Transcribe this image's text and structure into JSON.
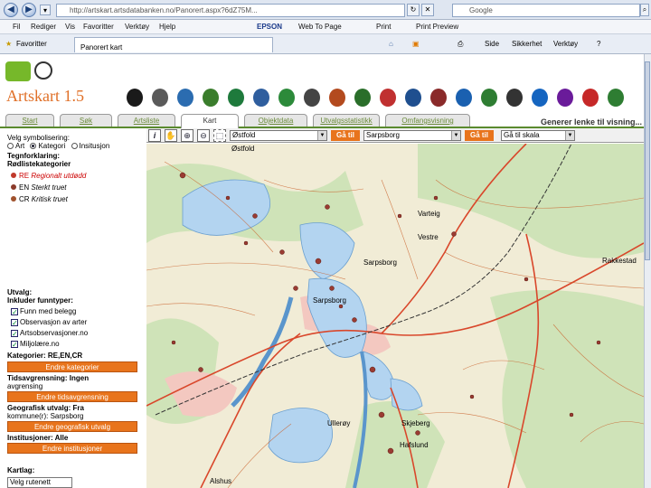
{
  "browser": {
    "url": "http://artskart.artsdatabanken.no/Panorert.aspx?6dZ75M...",
    "search_engine": "Google",
    "menu": [
      "Fil",
      "Rediger",
      "Vis",
      "Favoritter",
      "Verktøy",
      "Hjelp"
    ],
    "menu_extras": [
      "EPSON",
      "Web To Page",
      "Print",
      "Print Preview"
    ],
    "favorites_label": "Favoritter",
    "tab_title": "Panorert kart",
    "command_items": [
      "Side",
      "Sikkerhet",
      "Verktøy"
    ]
  },
  "app": {
    "title": "Artskart 1.5",
    "partner_logos": [
      "artsdatabanken-logo",
      "sabima-logo",
      "bio-logo",
      "biof-logo",
      "bioforsk-logo",
      "partner-logo-1",
      "partner-logo-2",
      "partner-logo-3",
      "partner-logo-4",
      "partner-logo-5",
      "partner-logo-6",
      "partner-logo-7",
      "partner-logo-8",
      "niva-logo",
      "partner-logo-9",
      "partner-logo-10",
      "partner-logo-11",
      "partner-logo-12",
      "partner-logo-13",
      "partner-logo-14"
    ],
    "tabs": [
      "Start",
      "Søk",
      "Artsliste",
      "Kart",
      "Objektdata",
      "Utvalgsstatistikk",
      "Omfangsvisning"
    ],
    "active_tab": "Kart",
    "generate_link": "Generer lenke til visning..."
  },
  "left_panel": {
    "symbol_heading": "Velg symbolisering:",
    "symbol_options": [
      "Art",
      "Kategori",
      "Insitusjon"
    ],
    "legend_heading": "Tegnforklaring:",
    "legend_subheading": "Rødlistekategorier",
    "legend_items": [
      {
        "code": "RE",
        "label": "Regionalt utdødd",
        "color": "#c0392b"
      },
      {
        "code": "EN",
        "label": "Sterkt truet",
        "color": "#8b3a2a"
      },
      {
        "code": "CR",
        "label": "Kritisk truet",
        "color": "#a0522d"
      }
    ],
    "selection_heading": "Utvalg:",
    "include_heading": "Inkluder funntyper:",
    "checkboxes": [
      "Funn med belegg",
      "Observasjon av arter",
      "Artsobservasjoner.no",
      "Miljolære.no"
    ],
    "categories_label": "Kategorier: RE,EN,CR",
    "btn_categories": "Endre kategorier",
    "time_label": "Tidsavgrensning: Ingen",
    "time_sub": "avgrensing",
    "btn_time": "Endre tidsavgrensning",
    "geo_label": "Geografisk utvalg: Fra",
    "geo_sub": "kommune(r): Sarpsborg",
    "btn_geo": "Endre geografisk utvalg",
    "inst_label": "Institusjoner: Alle",
    "btn_inst": "Endre institusjoner",
    "maplayer_heading": "Kartlag:",
    "maplayer_value": "Velg rutenett"
  },
  "map_toolbar": {
    "county": "Østfold",
    "go_label": "Gå til",
    "municipality": "Sarpsborg",
    "scale": "Gå til skala"
  },
  "map_labels": [
    "Østfold",
    "Sarpsborg",
    "Sarpsborg",
    "Vestre",
    "Rakkestad",
    "Skjeberg",
    "Ullerøy",
    "Alshus",
    "Hafslund",
    "Varteig"
  ]
}
